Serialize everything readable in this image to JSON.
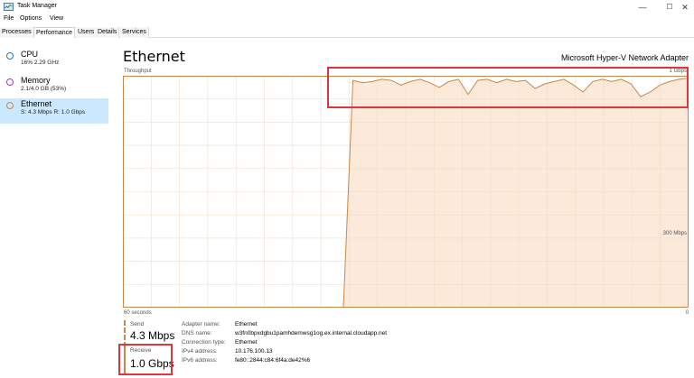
{
  "window": {
    "title": "Task Manager",
    "minimize": "—",
    "maximize": "☐",
    "close": "✕"
  },
  "menu": [
    "File",
    "Options",
    "View"
  ],
  "tabs": [
    {
      "label": "Processes",
      "active": false
    },
    {
      "label": "Performance",
      "active": true
    },
    {
      "label": "Users",
      "active": false
    },
    {
      "label": "Details",
      "active": false
    },
    {
      "label": "Services",
      "active": false
    }
  ],
  "sidebar": {
    "items": [
      {
        "label": "CPU",
        "sub": "16% 2.29 GHz",
        "color": "#1b7bd4",
        "selected": false
      },
      {
        "label": "Memory",
        "sub": "2.1/4.0 GB (53%)",
        "color": "#9b3fb7",
        "selected": false
      },
      {
        "label": "Ethernet",
        "sub": "S: 4.3 Mbps R: 1.0 Gbps",
        "color": "#c8864a",
        "selected": true
      }
    ]
  },
  "main": {
    "title": "Ethernet",
    "adapter": "Microsoft Hyper-V Network Adapter",
    "graph_label": "Throughput",
    "max_label": "1 Gbps",
    "mid_label": "300 Mbps",
    "time_label": "60 seconds",
    "zero_label": "0"
  },
  "throughput_graph": {
    "max_mbps": 1000,
    "window_seconds": 60,
    "accent": "#c8864a",
    "fill": "#fbe9da",
    "receive_mbps": [
      0,
      0,
      0,
      0,
      0,
      0,
      0,
      0,
      0,
      0,
      0,
      0,
      0,
      0,
      0,
      0,
      0,
      0,
      0,
      0,
      0,
      0,
      0,
      0,
      980,
      970,
      975,
      985,
      980,
      960,
      975,
      985,
      970,
      950,
      975,
      985,
      920,
      980,
      985,
      970,
      985,
      975,
      980,
      945,
      965,
      975,
      985,
      960,
      930,
      975,
      985,
      975,
      985,
      965,
      910,
      930,
      960,
      975,
      985,
      990
    ]
  },
  "stats": {
    "send_label": "Send",
    "send_value": "4.3 Mbps",
    "receive_label": "Receive",
    "receive_value": "1.0 Gbps"
  },
  "properties": [
    {
      "key": "Adapter name:",
      "value": "Ethernet"
    },
    {
      "key": "DNS name:",
      "value": "w3fn0bpxdgbu1pamhdemwsg1og.ex.internal.cloudapp.net"
    },
    {
      "key": "Connection type:",
      "value": "Ethernet"
    },
    {
      "key": "IPv4 address:",
      "value": "10.176.100.13"
    },
    {
      "key": "IPv6 address:",
      "value": "fe80::2844:c84:6f4a:de42%6"
    }
  ]
}
